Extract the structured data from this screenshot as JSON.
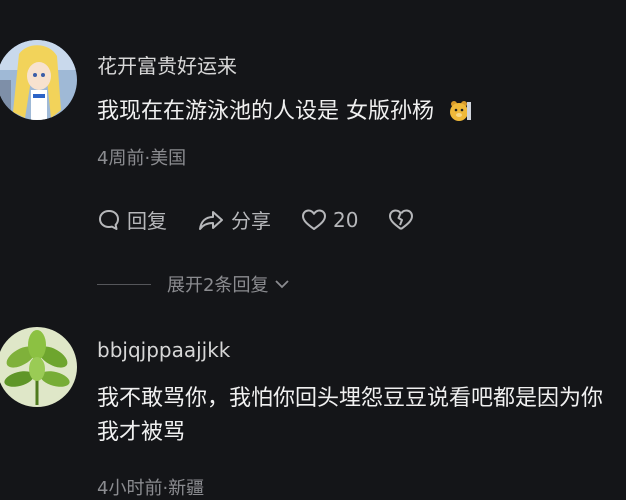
{
  "comments": [
    {
      "username": "花开富贵好运来",
      "text": "我现在在游泳池的人设是 女版孙杨",
      "emoji_icon": "bear-sticker-icon",
      "meta": "4周前·美国",
      "actions": {
        "reply": "回复",
        "share": "分享",
        "likes": "20"
      },
      "expand_label": "展开2条回复"
    },
    {
      "username": "bbjqjppaajjkk",
      "text": "我不敢骂你，我怕你回头埋怨豆豆说看吧都是因为你我才被骂",
      "meta": "4小时前·新疆"
    }
  ],
  "icons": {
    "reply": "comment-bubble-icon",
    "share": "share-arrow-icon",
    "like": "heart-icon",
    "dislike": "broken-heart-icon",
    "expand": "chevron-down-icon"
  }
}
